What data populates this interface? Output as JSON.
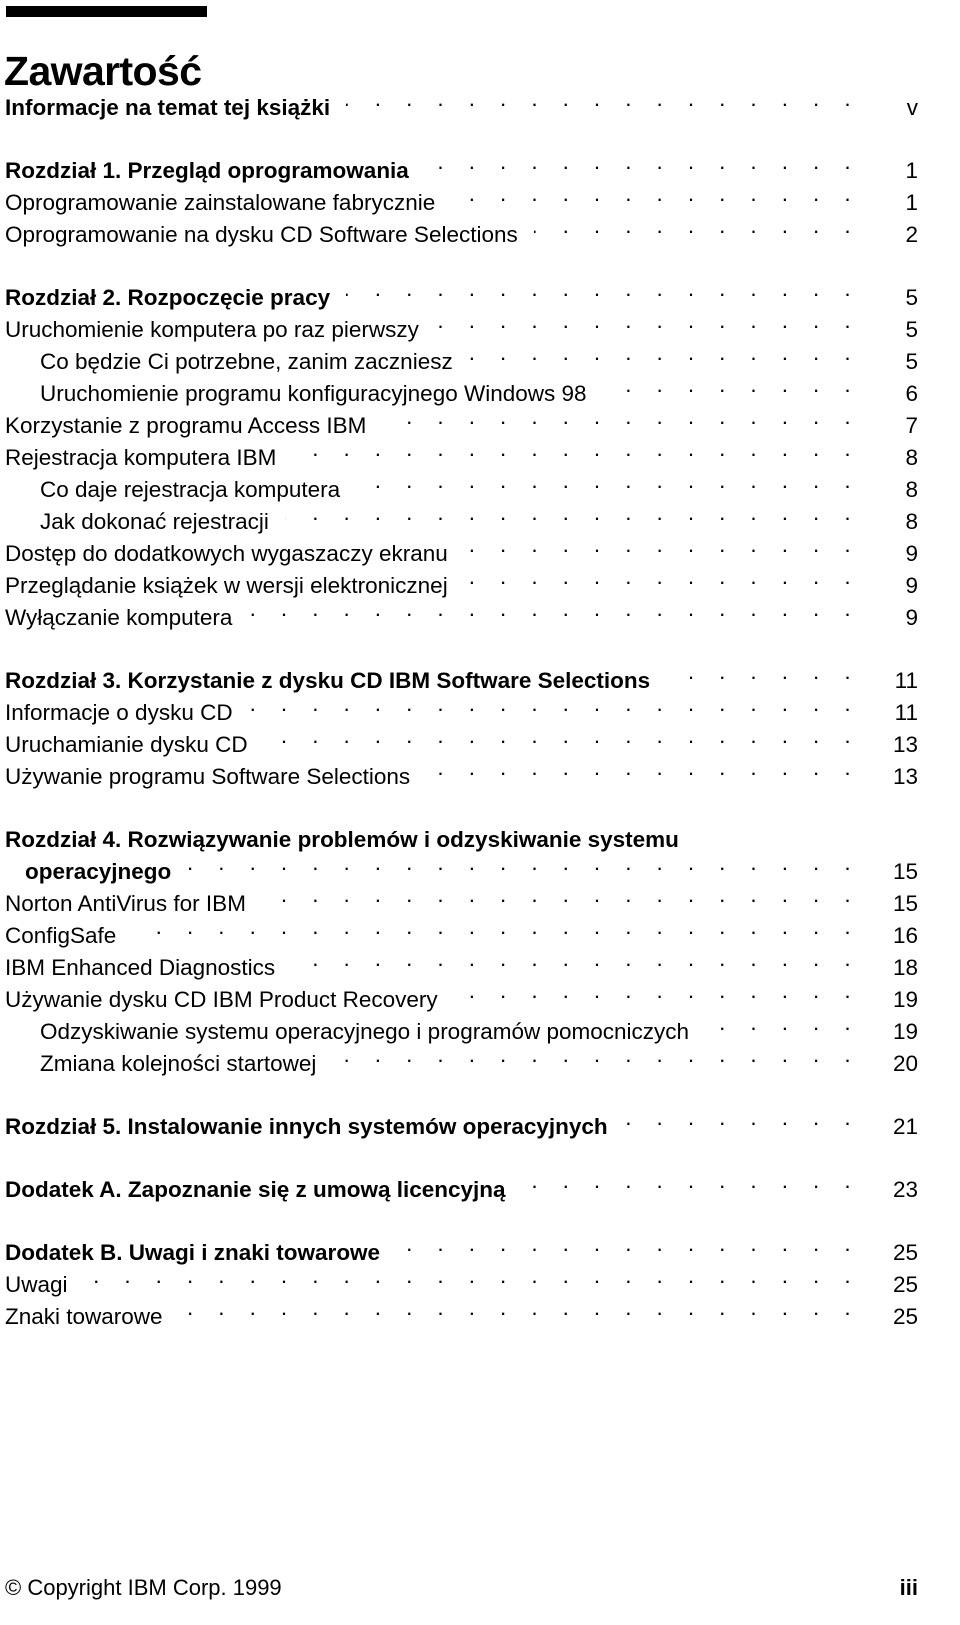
{
  "document": {
    "title": "Zawartość",
    "language": "pl"
  },
  "toc": {
    "entries": [
      {
        "label": "Informacje na temat tej książki",
        "page": "v",
        "level": 0,
        "bold": true,
        "gap_before": false
      },
      {
        "label": "Rozdział 1.  Przegląd oprogramowania",
        "page": "1",
        "level": 0,
        "bold": true,
        "gap_before": true
      },
      {
        "label": "Oprogramowanie zainstalowane fabrycznie",
        "page": "1",
        "level": 0,
        "bold": false,
        "gap_before": false
      },
      {
        "label": "Oprogramowanie na dysku CD Software Selections",
        "page": "2",
        "level": 0,
        "bold": false,
        "gap_before": false
      },
      {
        "label": "Rozdział 2.  Rozpoczęcie pracy",
        "page": "5",
        "level": 0,
        "bold": true,
        "gap_before": true
      },
      {
        "label": "Uruchomienie komputera po raz pierwszy",
        "page": "5",
        "level": 0,
        "bold": false,
        "gap_before": false
      },
      {
        "label": "Co będzie Ci potrzebne, zanim zaczniesz",
        "page": "5",
        "level": 1,
        "bold": false,
        "gap_before": false
      },
      {
        "label": "Uruchomienie programu konfiguracyjnego Windows 98",
        "page": "6",
        "level": 1,
        "bold": false,
        "gap_before": false
      },
      {
        "label": "Korzystanie z programu Access IBM",
        "page": "7",
        "level": 0,
        "bold": false,
        "gap_before": false
      },
      {
        "label": "Rejestracja komputera IBM",
        "page": "8",
        "level": 0,
        "bold": false,
        "gap_before": false
      },
      {
        "label": "Co daje rejestracja komputera",
        "page": "8",
        "level": 1,
        "bold": false,
        "gap_before": false
      },
      {
        "label": "Jak dokonać rejestracji",
        "page": "8",
        "level": 1,
        "bold": false,
        "gap_before": false
      },
      {
        "label": "Dostęp do dodatkowych wygaszaczy ekranu",
        "page": "9",
        "level": 0,
        "bold": false,
        "gap_before": false
      },
      {
        "label": "Przeglądanie książek w wersji elektronicznej",
        "page": "9",
        "level": 0,
        "bold": false,
        "gap_before": false
      },
      {
        "label": "Wyłączanie komputera",
        "page": "9",
        "level": 0,
        "bold": false,
        "gap_before": false
      },
      {
        "label": "Rozdział 3.  Korzystanie z dysku CD IBM Software Selections",
        "page": "11",
        "level": 0,
        "bold": true,
        "gap_before": true
      },
      {
        "label": "Informacje o dysku CD",
        "page": "11",
        "level": 0,
        "bold": false,
        "gap_before": false
      },
      {
        "label": "Uruchamianie dysku CD",
        "page": "13",
        "level": 0,
        "bold": false,
        "gap_before": false
      },
      {
        "label": "Używanie programu Software Selections",
        "page": "13",
        "level": 0,
        "bold": false,
        "gap_before": false
      },
      {
        "label": "Rozdział 4.  Rozwiązywanie problemów i odzyskiwanie systemu",
        "page": "",
        "level": 0,
        "bold": true,
        "gap_before": true,
        "no_leader": true
      },
      {
        "label": "operacyjnego",
        "page": "15",
        "level": 0,
        "bold": true,
        "gap_before": false,
        "continuation": true
      },
      {
        "label": "Norton AntiVirus for IBM",
        "page": "15",
        "level": 0,
        "bold": false,
        "gap_before": false
      },
      {
        "label": "ConfigSafe",
        "page": "16",
        "level": 0,
        "bold": false,
        "gap_before": false
      },
      {
        "label": "IBM Enhanced Diagnostics",
        "page": "18",
        "level": 0,
        "bold": false,
        "gap_before": false
      },
      {
        "label": "Używanie dysku CD IBM Product Recovery",
        "page": "19",
        "level": 0,
        "bold": false,
        "gap_before": false
      },
      {
        "label": "Odzyskiwanie systemu operacyjnego i programów pomocniczych",
        "page": "19",
        "level": 1,
        "bold": false,
        "gap_before": false
      },
      {
        "label": "Zmiana kolejności startowej",
        "page": "20",
        "level": 1,
        "bold": false,
        "gap_before": false
      },
      {
        "label": "Rozdział 5.  Instalowanie innych systemów operacyjnych",
        "page": "21",
        "level": 0,
        "bold": true,
        "gap_before": true
      },
      {
        "label": "Dodatek A.  Zapoznanie się z umową licencyjną",
        "page": "23",
        "level": 0,
        "bold": true,
        "gap_before": true
      },
      {
        "label": "Dodatek B.  Uwagi i znaki towarowe",
        "page": "25",
        "level": 0,
        "bold": true,
        "gap_before": true
      },
      {
        "label": "Uwagi",
        "page": "25",
        "level": 0,
        "bold": false,
        "gap_before": false
      },
      {
        "label": "Znaki towarowe",
        "page": "25",
        "level": 0,
        "bold": false,
        "gap_before": false
      }
    ]
  },
  "footer": {
    "copyright": "© Copyright IBM Corp. 1999",
    "folio": "iii"
  }
}
